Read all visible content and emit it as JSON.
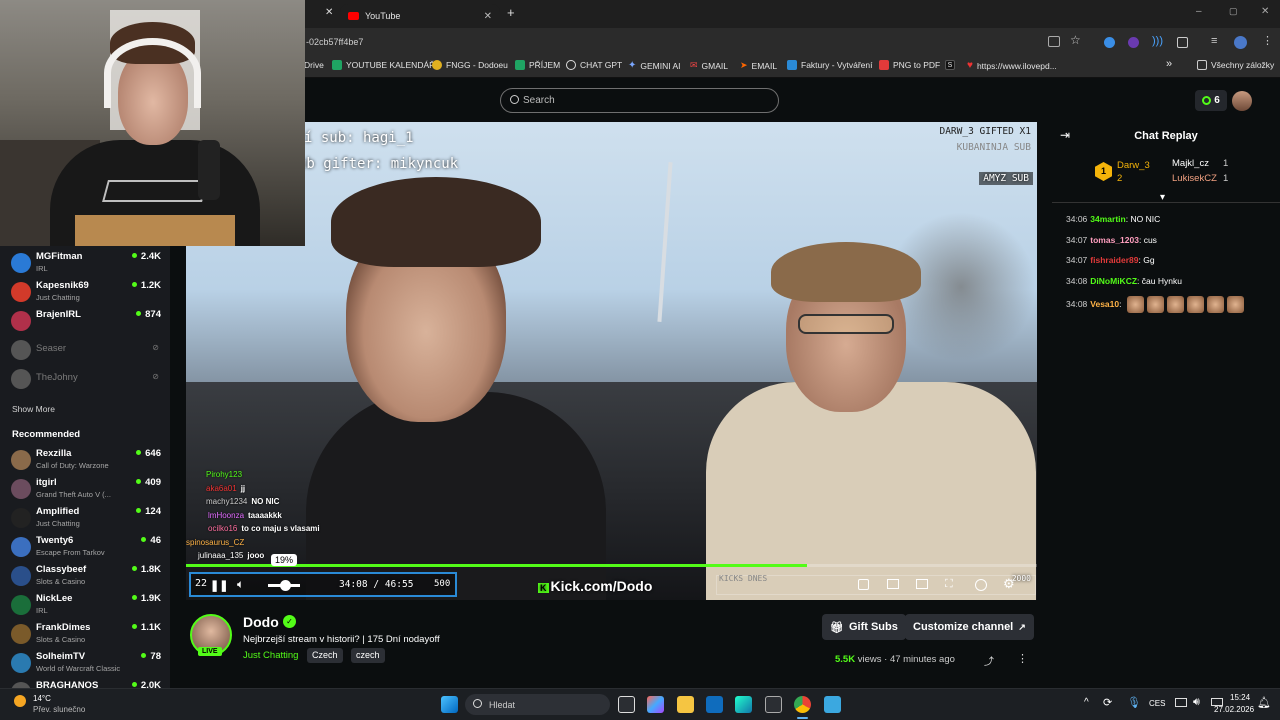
{
  "browser": {
    "tabs": [
      {
        "label": "YouTube"
      }
    ],
    "new_tab": "+",
    "url": "-02cb57ff4be7",
    "bookmarks": [
      "Drive",
      "YOUTUBE KALENDÁŘ",
      "FNGG - Dodoeu",
      "PŘÍJEM",
      "CHAT GPT",
      "GEMINI AI",
      "GMAIL",
      "EMAIL",
      "Faktury - Vytváření",
      "PNG to PDF",
      "S",
      "https://www.ilovepd..."
    ],
    "bookmarks_more": "»",
    "all_bookmarks": "Všechny záložky",
    "window_controls": [
      "–",
      "▢",
      "✕"
    ]
  },
  "header": {
    "search_placeholder": "Search",
    "coins": "6"
  },
  "sidebar": {
    "channels": [
      {
        "name": "MGFitman",
        "category": "IRL",
        "viewers": "2.4K",
        "color": "#2a7ad6"
      },
      {
        "name": "Kapesnik69",
        "category": "Just Chatting",
        "viewers": "1.2K",
        "color": "#d23a2a"
      },
      {
        "name": "BrajenIRL",
        "category": "",
        "viewers": "874",
        "color": "#b0304a"
      },
      {
        "name": "Seaser",
        "offline": true,
        "color": "#555"
      },
      {
        "name": "TheJohny",
        "offline": true,
        "color": "#555"
      }
    ],
    "show_more": "Show More",
    "recommended_title": "Recommended",
    "recommended": [
      {
        "name": "Rexzilla",
        "category": "Call of Duty: Warzone",
        "viewers": "646",
        "color": "#8a6a4a"
      },
      {
        "name": "itgirl",
        "category": "Grand Theft Auto V (...",
        "viewers": "409",
        "color": "#6b4c5e"
      },
      {
        "name": "Amplified",
        "category": "Just Chatting",
        "viewers": "124",
        "color": "#222"
      },
      {
        "name": "Twenty6",
        "category": "Escape From Tarkov",
        "viewers": "46",
        "color": "#3b6fbf"
      },
      {
        "name": "Classybeef",
        "category": "Slots & Casino",
        "viewers": "1.8K",
        "color": "#2a4f8a"
      },
      {
        "name": "NickLee",
        "category": "IRL",
        "viewers": "1.9K",
        "color": "#1a6e3a"
      },
      {
        "name": "FrankDimes",
        "category": "Slots & Casino",
        "viewers": "1.1K",
        "color": "#7a5a2a"
      },
      {
        "name": "SolheimTV",
        "category": "World of Warcraft Classic",
        "viewers": "78",
        "color": "#2a7ab0"
      },
      {
        "name": "BRAGHANOS",
        "category": "",
        "viewers": "2.0K",
        "color": "#555"
      }
    ]
  },
  "video": {
    "overlay_sub": "í sub: hagi_1",
    "overlay_gifter": "ub gifter: mikyncuk",
    "overlay_right1": "DARW_3  GIFTED X1",
    "overlay_right2": "KUBANINJA  SUB",
    "overlay_right3": "AMYZ  SUB",
    "overlay_chat": [
      {
        "user": "Pirohy123",
        "msg": "",
        "color": "#53fc18"
      },
      {
        "user": "aka6a01",
        "msg": "jj",
        "color": "#e33"
      },
      {
        "user": "machy1234",
        "msg": "NO NIC",
        "color": "#ccc"
      },
      {
        "user": "lmHoonza",
        "msg": "taaaakkk",
        "color": "#e26bff"
      },
      {
        "user": "ocilko16",
        "msg": "to co maju s vlasami",
        "color": "#ff6f9f"
      },
      {
        "user": "spinosaurus_CZ",
        "msg": "",
        "color": "#ffb347"
      },
      {
        "user": "julinaaa_135",
        "msg": "jooo",
        "color": "#fff"
      }
    ],
    "volume_tooltip": "19%",
    "current_time": "34:08",
    "duration": "46:55",
    "time_sep": "/",
    "left_time": "22",
    "overlay_500": "500",
    "overlay_2000": "2000",
    "watermark": "Kick.com/Dodo",
    "kicks_label": "KICKS DNES",
    "progress": 0.73
  },
  "channel": {
    "name": "Dodo",
    "live_badge": "LIVE",
    "title": "Nejbrzejší stream v historii? | 175 Dní nodayoff",
    "category": "Just Chatting",
    "tags": [
      "Czech",
      "czech"
    ],
    "gift_subs": "Gift Subs",
    "customize": "Customize channel",
    "views": "5.5K",
    "views_label": "views",
    "time_ago": "47 minutes ago"
  },
  "chat": {
    "title": "Chat Replay",
    "leaders": [
      {
        "name": "Darw_3",
        "count": "2",
        "rank": "1"
      },
      {
        "name": "Majkl_cz",
        "count": "1"
      },
      {
        "name": "LukisekCZ",
        "count": "1"
      }
    ],
    "messages": [
      {
        "time": "34:06",
        "user": "34martin",
        "msg": "NO NIC",
        "color": "#53fc18"
      },
      {
        "time": "34:07",
        "user": "tomas_1203",
        "msg": "cus",
        "color": "#ff9fbf"
      },
      {
        "time": "34:07",
        "user": "fishraider89",
        "msg": "Gg",
        "color": "#e23a3a"
      },
      {
        "time": "34:08",
        "user": "DiNoMiKCZ",
        "msg": "čau Hynku",
        "color": "#53fc18"
      },
      {
        "time": "34:08",
        "user": "Vesa10",
        "msg": "",
        "color": "#ffb347"
      }
    ]
  },
  "taskbar": {
    "weather_temp": "14°C",
    "weather_desc": "Přev. slunečno",
    "search_placeholder": "Hledat",
    "lang": "CES",
    "time": "15:24",
    "date": "27.02.2026"
  }
}
